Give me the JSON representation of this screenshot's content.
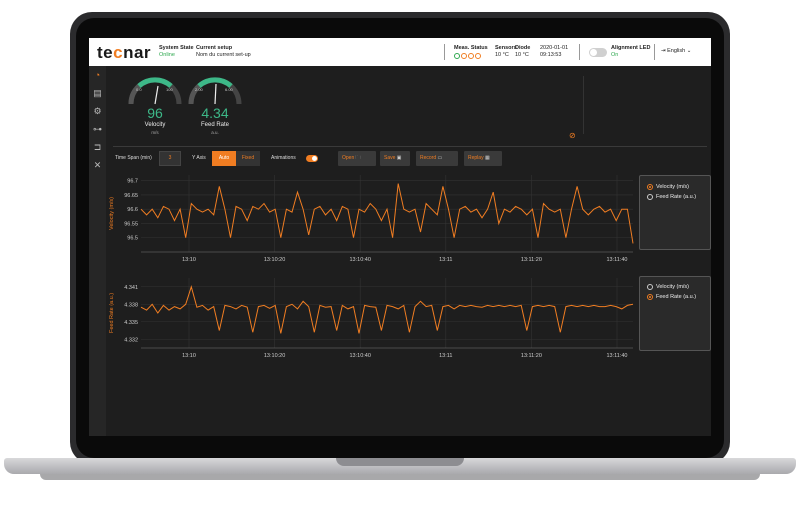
{
  "header": {
    "logo": "tecnar",
    "system_state_label": "System State",
    "system_state_value": "Online",
    "setup_label": "Current setup",
    "setup_value": "Nom du current set-up",
    "meas_status_label": "Meas. Status",
    "sensors_label": "Sensors",
    "sensors_value": "10 °C",
    "diode_label": "Diode",
    "diode_value": "10 °C",
    "date": "2020-01-01",
    "time": "09:13:53",
    "alignment_label": "Alignment LED",
    "alignment_value": "On",
    "language": "English"
  },
  "gauges": [
    {
      "label": "Velocity",
      "unit": "m/s",
      "value": "96",
      "min": "0.0",
      "max": "100"
    },
    {
      "label": "Feed Rate",
      "unit": "a.u.",
      "value": "4.34",
      "min": "2.00",
      "max": "6.00"
    }
  ],
  "toolbar": {
    "time_span_label": "Time Span (min)",
    "time_span_value": "3",
    "y_axis_label": "Y Axis",
    "auto_label": "Auto",
    "fixed_label": "Fixed",
    "animations_label": "Animations",
    "open_label": "Open",
    "save_label": "Save",
    "record_label": "Record",
    "replay_label": "Replay"
  },
  "colors": {
    "accent": "#f07d22",
    "green": "#2ea84f",
    "teal": "#3db888"
  },
  "chart_data": [
    {
      "type": "line",
      "ylabel": "Velocity (m/s)",
      "ylim": [
        96.45,
        96.72
      ],
      "yticks": [
        "96.7",
        "96.65",
        "96.6",
        "96.55",
        "96.5"
      ],
      "x": [
        "13:10",
        "13:10:20",
        "13:10:40",
        "13:11",
        "13:11:20",
        "13:11:40"
      ],
      "series": [
        {
          "name": "Velocity (m/s)",
          "values": [
            96.6,
            96.58,
            96.6,
            96.57,
            96.61,
            96.6,
            96.56,
            96.6,
            96.5,
            96.62,
            96.6,
            96.59,
            96.6,
            96.58,
            96.68,
            96.6,
            96.5,
            96.61,
            96.6,
            96.56,
            96.61,
            96.6,
            96.62,
            96.59,
            96.6,
            96.5,
            96.6,
            96.59,
            96.66,
            96.6,
            96.51,
            96.6,
            96.61,
            96.58,
            96.6,
            96.56,
            96.61,
            96.6,
            96.5,
            96.6,
            96.59,
            96.62,
            96.6,
            96.56,
            96.6,
            96.5,
            96.69,
            96.6,
            96.59,
            96.6,
            96.52,
            96.62,
            96.6,
            96.58,
            96.68,
            96.6,
            96.5,
            96.6,
            96.61,
            96.59,
            96.6,
            96.57,
            96.6,
            96.66,
            96.55,
            96.6,
            96.59,
            96.61,
            96.6,
            96.58,
            96.6,
            96.5,
            96.62,
            96.6,
            96.59,
            96.6,
            96.5,
            96.6,
            96.68,
            96.6,
            96.58,
            96.6,
            96.61,
            96.59,
            96.6,
            96.56,
            96.6,
            96.6,
            96.48
          ]
        }
      ],
      "legend": [
        "Velocity (m/s)",
        "Feed Rate (a.u.)"
      ],
      "legend_selected": 0
    },
    {
      "type": "line",
      "ylabel": "Feed Rate (a.u.)",
      "ylim": [
        4.3305,
        4.3425
      ],
      "yticks": [
        "4.341",
        "4.338",
        "4.335",
        "4.332"
      ],
      "x": [
        "13:10",
        "13:10:20",
        "13:10:40",
        "13:11",
        "13:11:20",
        "13:11:40"
      ],
      "series": [
        {
          "name": "Feed Rate (a.u.)",
          "values": [
            4.3375,
            4.337,
            4.338,
            4.3365,
            4.3378,
            4.337,
            4.3376,
            4.3372,
            4.338,
            4.341,
            4.3375,
            4.3378,
            4.337,
            4.3376,
            4.3335,
            4.3378,
            4.3376,
            4.3372,
            4.3378,
            4.3375,
            4.3332,
            4.3376,
            4.3378,
            4.3373,
            4.3378,
            4.333,
            4.3376,
            4.338,
            4.3372,
            4.3385,
            4.3376,
            4.3332,
            4.3378,
            4.3375,
            4.3376,
            4.3335,
            4.3378,
            4.3372,
            4.3376,
            4.333,
            4.3378,
            4.3376,
            4.3375,
            4.3335,
            4.3378,
            4.3376,
            4.3372,
            4.3378,
            4.3332,
            4.3376,
            4.3385,
            4.3376,
            4.3378,
            4.3335,
            4.3376,
            4.3378,
            4.3372,
            4.3378,
            4.3376,
            4.3378,
            4.3376,
            4.3375,
            4.3378,
            4.3376,
            4.3378,
            4.3376,
            4.3378,
            4.3376,
            4.3378,
            4.3335,
            4.3376,
            4.3378,
            4.3376,
            4.3378,
            4.3376,
            4.3332,
            4.3376,
            4.3378,
            4.3376,
            4.3378,
            4.3376,
            4.3378,
            4.3376,
            4.3376,
            4.3378,
            4.3376,
            4.3372,
            4.3378,
            4.338
          ]
        }
      ],
      "legend": [
        "Velocity (m/s)",
        "Feed Rate (a.u.)"
      ],
      "legend_selected": 1
    }
  ]
}
